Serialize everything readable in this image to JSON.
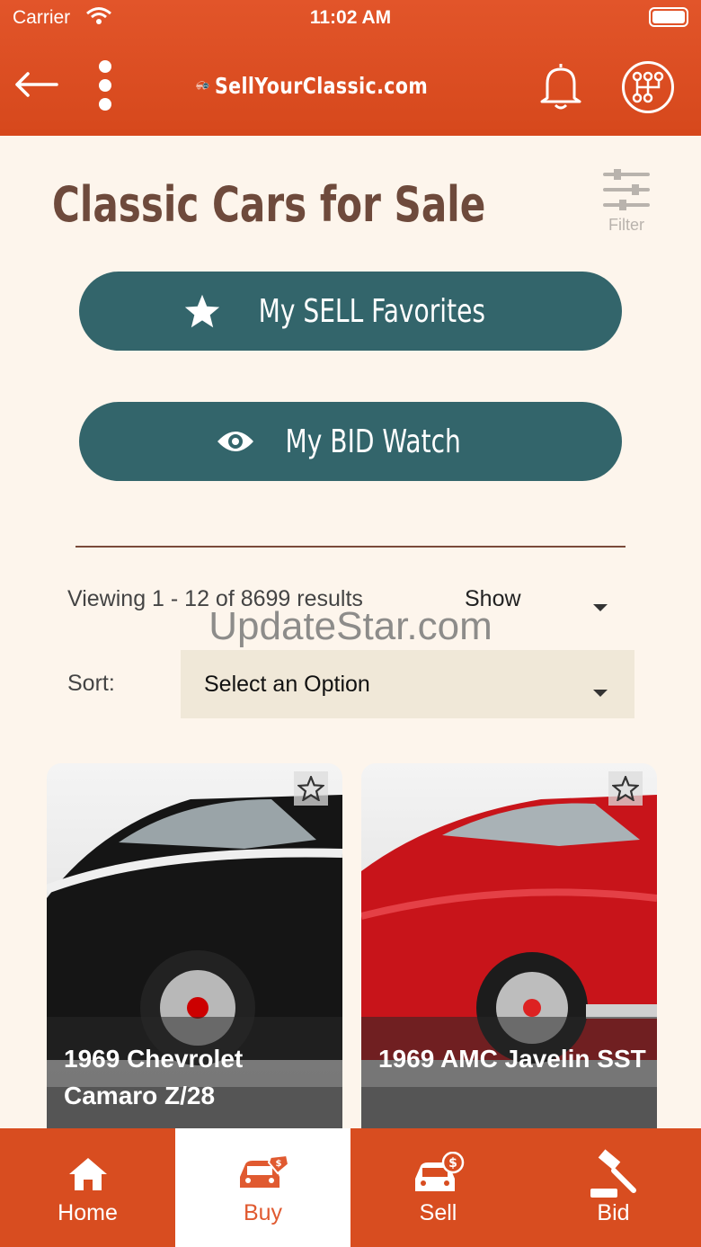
{
  "status_bar": {
    "carrier": "Carrier",
    "time": "11:02 AM"
  },
  "header": {
    "logo_badge": "SYC",
    "logo_text": "SellYourClassic.com"
  },
  "page": {
    "title": "Classic Cars for Sale",
    "filter_label": "Filter",
    "sell_favorites_label": "My SELL Favorites",
    "bid_watch_label": "My BID Watch"
  },
  "results": {
    "viewing_text": "Viewing 1 - 12 of 8699 results",
    "show_label": "Show",
    "sort_label": "Sort:",
    "sort_value": "Select an Option"
  },
  "watermark": "UpdateStar.com",
  "cards": [
    {
      "title": "1969 Chevrolet Camaro Z/28",
      "body_color": "#151515"
    },
    {
      "title": "1969 AMC Javelin SST",
      "body_color": "#c8141a"
    }
  ],
  "tabs": [
    {
      "label": "Home",
      "icon": "home-icon"
    },
    {
      "label": "Buy",
      "icon": "car-tag-icon",
      "active": true
    },
    {
      "label": "Sell",
      "icon": "car-dollar-icon"
    },
    {
      "label": "Bid",
      "icon": "gavel-icon"
    }
  ],
  "colors": {
    "header": "#d84d20",
    "accent": "#33656b",
    "title": "#6e4a3c",
    "background": "#fdf5ec"
  }
}
